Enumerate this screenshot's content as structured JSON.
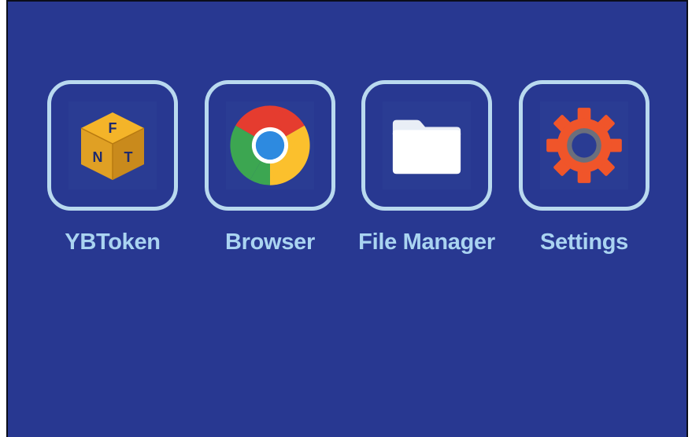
{
  "apps": [
    {
      "label": "YBToken",
      "icon": "cube-icon",
      "cube_letters": [
        "F",
        "N",
        "T"
      ],
      "colors": {
        "face_top": "#f4b429",
        "face_left": "#e0a024",
        "face_right": "#c98a1c"
      }
    },
    {
      "label": "Browser",
      "icon": "chrome-icon",
      "colors": {
        "red": "#e53c2f",
        "yellow": "#fbc02d",
        "green": "#3ca651",
        "blue": "#2d8ae0"
      }
    },
    {
      "label": "File Manager",
      "icon": "folder-icon",
      "colors": {
        "folder": "#ffffff"
      }
    },
    {
      "label": "Settings",
      "icon": "gear-icon",
      "colors": {
        "gear": "#f0552a",
        "hub": "#6b6f7c"
      }
    }
  ],
  "theme": {
    "background": "#283891",
    "tile_border": "#b9d9ef",
    "label_color": "#aad4f1"
  }
}
